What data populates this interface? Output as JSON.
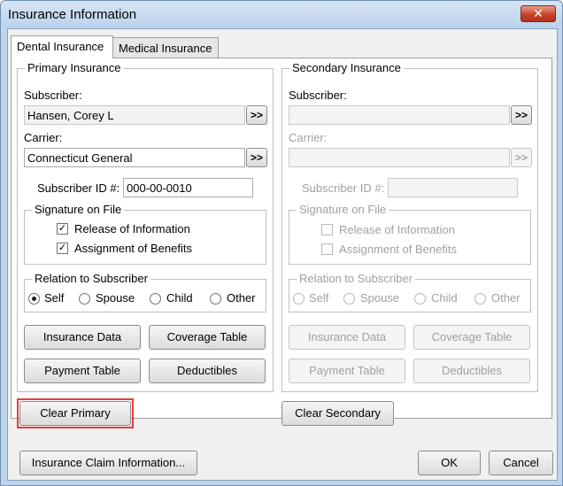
{
  "window": {
    "title": "Insurance Information",
    "close_glyph": "✕"
  },
  "tabs": [
    {
      "label": "Dental Insurance",
      "active": true
    },
    {
      "label": "Medical Insurance",
      "active": false
    }
  ],
  "primary": {
    "group_label": "Primary Insurance",
    "subscriber_label": "Subscriber:",
    "subscriber_value": "Hansen, Corey L",
    "carrier_label": "Carrier:",
    "carrier_value": "Connecticut General",
    "browse_label": ">>",
    "subscriber_id_label": "Subscriber ID #:",
    "subscriber_id_value": "000-00-0010",
    "signature_group": "Signature on File",
    "release_label": "Release of Information",
    "release_checked": true,
    "assignment_label": "Assignment of Benefits",
    "assignment_checked": true,
    "relation_group": "Relation to Subscriber",
    "relations": [
      "Self",
      "Spouse",
      "Child",
      "Other"
    ],
    "selected_relation": "Self",
    "insurance_data_btn": "Insurance Data",
    "coverage_table_btn": "Coverage Table",
    "payment_table_btn": "Payment Table",
    "deductibles_btn": "Deductibles",
    "clear_btn": "Clear Primary"
  },
  "secondary": {
    "group_label": "Secondary Insurance",
    "subscriber_label": "Subscriber:",
    "subscriber_value": "",
    "carrier_label": "Carrier:",
    "carrier_value": "",
    "browse_label": ">>",
    "subscriber_id_label": "Subscriber ID #:",
    "subscriber_id_value": "",
    "signature_group": "Signature on File",
    "release_label": "Release of Information",
    "assignment_label": "Assignment of Benefits",
    "relation_group": "Relation to Subscriber",
    "relations": [
      "Self",
      "Spouse",
      "Child",
      "Other"
    ],
    "insurance_data_btn": "Insurance Data",
    "coverage_table_btn": "Coverage Table",
    "payment_table_btn": "Payment Table",
    "deductibles_btn": "Deductibles",
    "clear_btn": "Clear Secondary"
  },
  "footer": {
    "claim_info_btn": "Insurance Claim Information...",
    "ok_btn": "OK",
    "cancel_btn": "Cancel"
  },
  "colors": {
    "highlight": "#e0403a",
    "close_button": "#c7432a"
  }
}
